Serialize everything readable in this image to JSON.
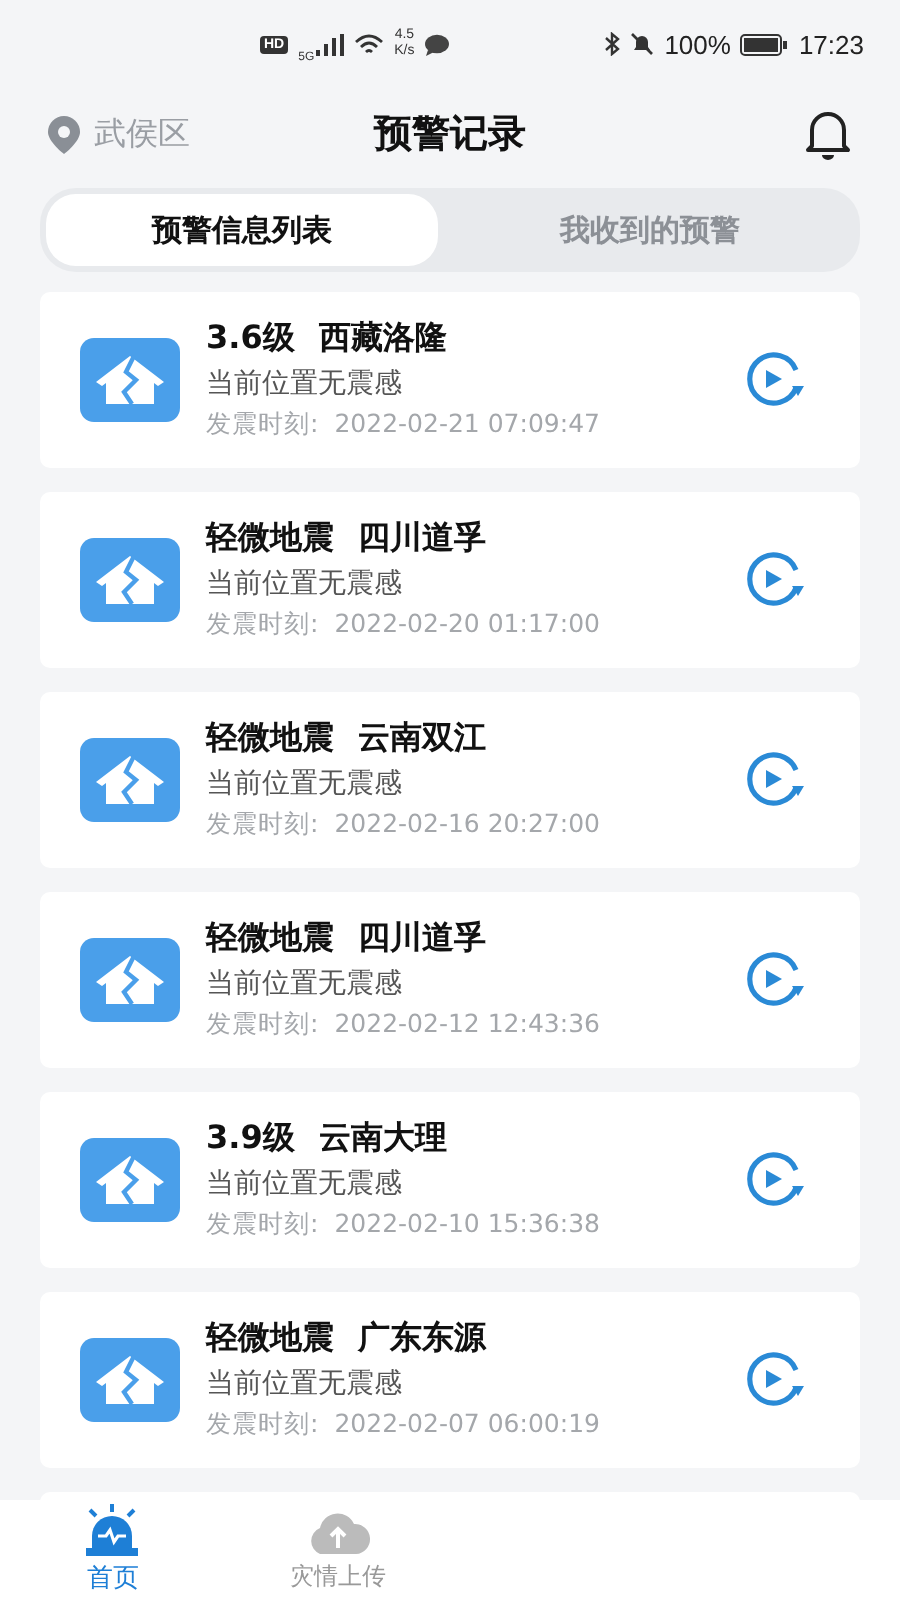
{
  "status_bar": {
    "hd": "HD",
    "network": "5G",
    "speed_value": "4.5",
    "speed_unit": "K/s",
    "battery": "100%",
    "time": "17:23"
  },
  "header": {
    "location": "武侯区",
    "title": "预警记录"
  },
  "tabs": [
    {
      "label": "预警信息列表",
      "selected": true
    },
    {
      "label": "我收到的预警",
      "selected": false
    }
  ],
  "alerts": [
    {
      "title": "3.6级",
      "place": "西藏洛隆",
      "note": "当前位置无震感",
      "time_label": "发震时刻:",
      "time": "2022-02-21 07:09:47"
    },
    {
      "title": "轻微地震",
      "place": "四川道孚",
      "note": "当前位置无震感",
      "time_label": "发震时刻:",
      "time": "2022-02-20 01:17:00"
    },
    {
      "title": "轻微地震",
      "place": "云南双江",
      "note": "当前位置无震感",
      "time_label": "发震时刻:",
      "time": "2022-02-16 20:27:00"
    },
    {
      "title": "轻微地震",
      "place": "四川道孚",
      "note": "当前位置无震感",
      "time_label": "发震时刻:",
      "time": "2022-02-12 12:43:36"
    },
    {
      "title": "3.9级",
      "place": "云南大理",
      "note": "当前位置无震感",
      "time_label": "发震时刻:",
      "time": "2022-02-10 15:36:38"
    },
    {
      "title": "轻微地震",
      "place": "广东东源",
      "note": "当前位置无震感",
      "time_label": "发震时刻:",
      "time": "2022-02-07 06:00:19"
    }
  ],
  "bottom_nav": [
    {
      "label": "首页",
      "kind": "alarm",
      "selected": true
    },
    {
      "label": "灾情上传",
      "kind": "upload",
      "selected": false
    }
  ]
}
